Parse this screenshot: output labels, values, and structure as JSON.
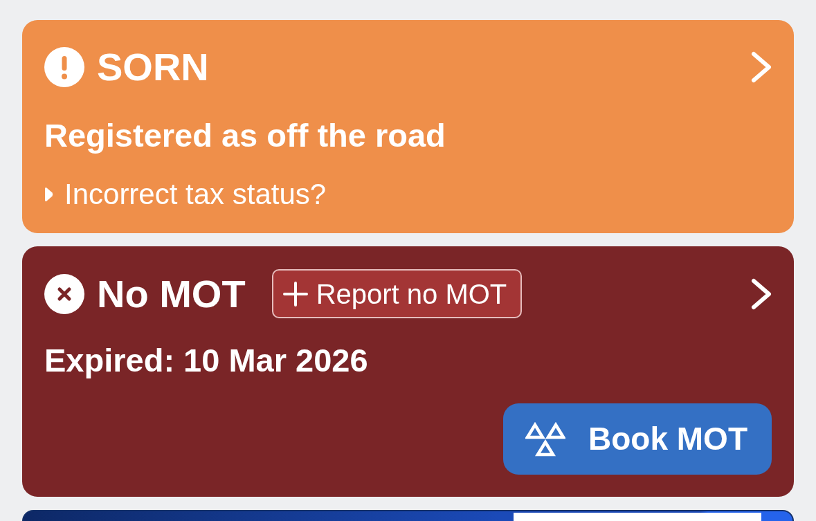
{
  "status_cards": [
    {
      "kind": "warning",
      "title": "SORN",
      "description": "Registered as off the road",
      "disclosure": "Incorrect tax status?"
    },
    {
      "kind": "error",
      "title": "No MOT",
      "title_action": "Report no MOT",
      "description": "Expired: 10 Mar 2026",
      "primary_action": "Book MOT"
    }
  ]
}
